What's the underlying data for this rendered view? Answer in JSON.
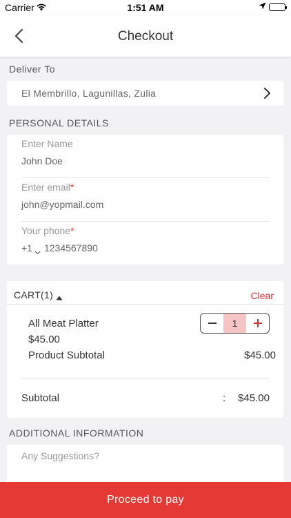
{
  "status_bar": {
    "carrier": "Carrier",
    "time": "1:51 AM"
  },
  "nav": {
    "title": "Checkout"
  },
  "deliver": {
    "section_label": "Deliver To",
    "address": "El Membrillo, Lagunillas, Zulia"
  },
  "personal": {
    "section_label": "PERSONAL DETAILS",
    "name": {
      "label": "Enter Name",
      "value": "John Doe"
    },
    "email": {
      "label": "Enter email",
      "required_mark": "*",
      "value": "john@yopmail.com"
    },
    "phone": {
      "label": "Your phone",
      "required_mark": "*",
      "country_code": "+1",
      "value": "1234567890"
    }
  },
  "cart": {
    "title": "CART(1)",
    "clear_label": "Clear",
    "item": {
      "name": "All Meat Platter",
      "price": "$45.00",
      "quantity": "1",
      "subtotal_label": "Product Subtotal",
      "subtotal_value": "$45.00"
    },
    "subtotal_label": "Subtotal",
    "subtotal_colon": ":",
    "subtotal_value": "$45.00"
  },
  "additional": {
    "section_label": "ADDITIONAL INFORMATION",
    "placeholder": "Any Suggestions?"
  },
  "proceed_label": "Proceed to pay",
  "colors": {
    "accent": "#e53935",
    "stepper_qty_bg": "#f5c4c4",
    "page_bg": "#f2f2f4"
  }
}
